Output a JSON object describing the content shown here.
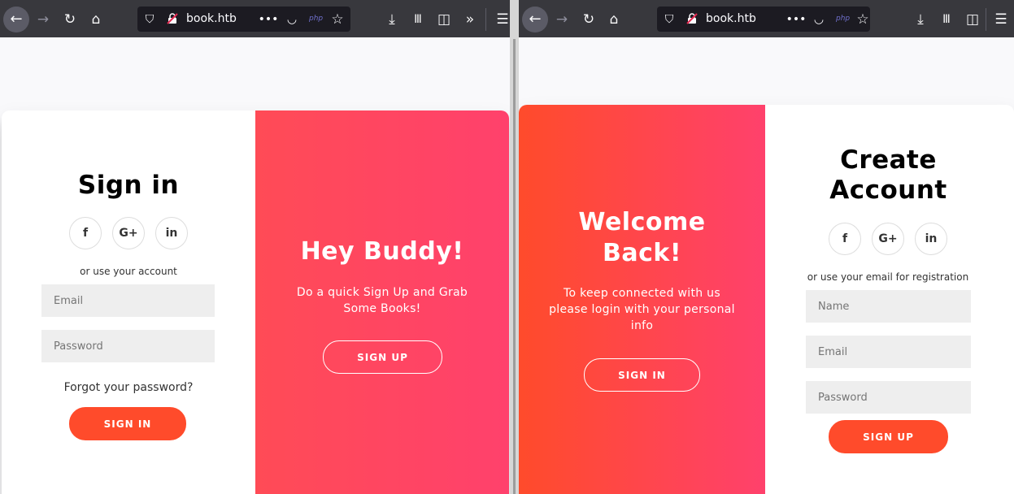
{
  "browser_left": {
    "url": "book.htb",
    "php_badge": "php",
    "icons": [
      "back-icon",
      "forward-icon",
      "reload-icon",
      "home-icon",
      "shield-icon",
      "insecure-lock-icon",
      "page-actions-icon",
      "pocket-icon",
      "bookmark-star-icon",
      "download-icon",
      "library-icon",
      "sidebar-icon",
      "overflow-icon",
      "menu-icon"
    ]
  },
  "browser_right": {
    "url": "book.htb",
    "php_badge": "php"
  },
  "signin_page": {
    "form": {
      "title": "Sign in",
      "social": {
        "facebook": "f",
        "google": "G+",
        "linkedin": "in"
      },
      "alt_text": "or use your account",
      "email_placeholder": "Email",
      "password_placeholder": "Password",
      "forgot_link": "Forgot your password?",
      "submit_label": "SIGN IN"
    },
    "overlay": {
      "title": "Hey Buddy!",
      "text": "Do a quick Sign Up and Grab Some Books!",
      "button_label": "SIGN UP"
    }
  },
  "signup_page": {
    "overlay": {
      "title": "Welcome Back!",
      "text": "To keep connected with us please login with your personal info",
      "button_label": "SIGN IN"
    },
    "form": {
      "title": "Create Account",
      "social": {
        "facebook": "f",
        "google": "G+",
        "linkedin": "in"
      },
      "alt_text": "or use your email for registration",
      "name_placeholder": "Name",
      "email_placeholder": "Email",
      "password_placeholder": "Password",
      "submit_label": "SIGN UP"
    }
  },
  "colors": {
    "toolbar": "#38383d",
    "urlbar": "#1c1b22",
    "accent": "#ff4b2b",
    "overlay_gradient_end": "#ff416c",
    "input_bg": "#eeeeee"
  }
}
